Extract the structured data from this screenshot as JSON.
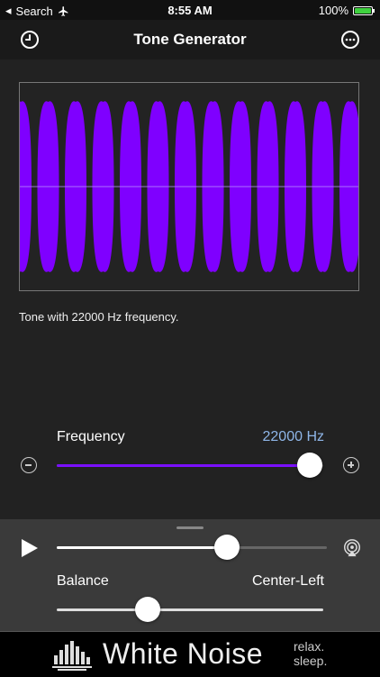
{
  "status": {
    "back_app": "Search",
    "time": "8:55 AM",
    "battery": "100%"
  },
  "nav": {
    "title": "Tone Generator"
  },
  "main": {
    "description": "Tone with 22000 Hz frequency."
  },
  "frequency": {
    "label": "Frequency",
    "value": "22000 Hz",
    "fraction": 0.95
  },
  "playback": {
    "progress": 0.63
  },
  "balance": {
    "label": "Balance",
    "value": "Center-Left",
    "fraction": 0.34
  },
  "banner": {
    "title": "White Noise",
    "tagline_1": "relax.",
    "tagline_2": "sleep."
  },
  "colors": {
    "wave": "#7f00ff",
    "accent": "#7a10ff",
    "frequency_text": "#8fb6e8",
    "battery": "#3fd13f"
  },
  "icons": {
    "history": "clock-icon",
    "menu": "ellipsis-icon",
    "minus": "minus-circle-icon",
    "plus": "plus-circle-icon",
    "play": "play-icon",
    "airplay": "airplay-icon"
  }
}
